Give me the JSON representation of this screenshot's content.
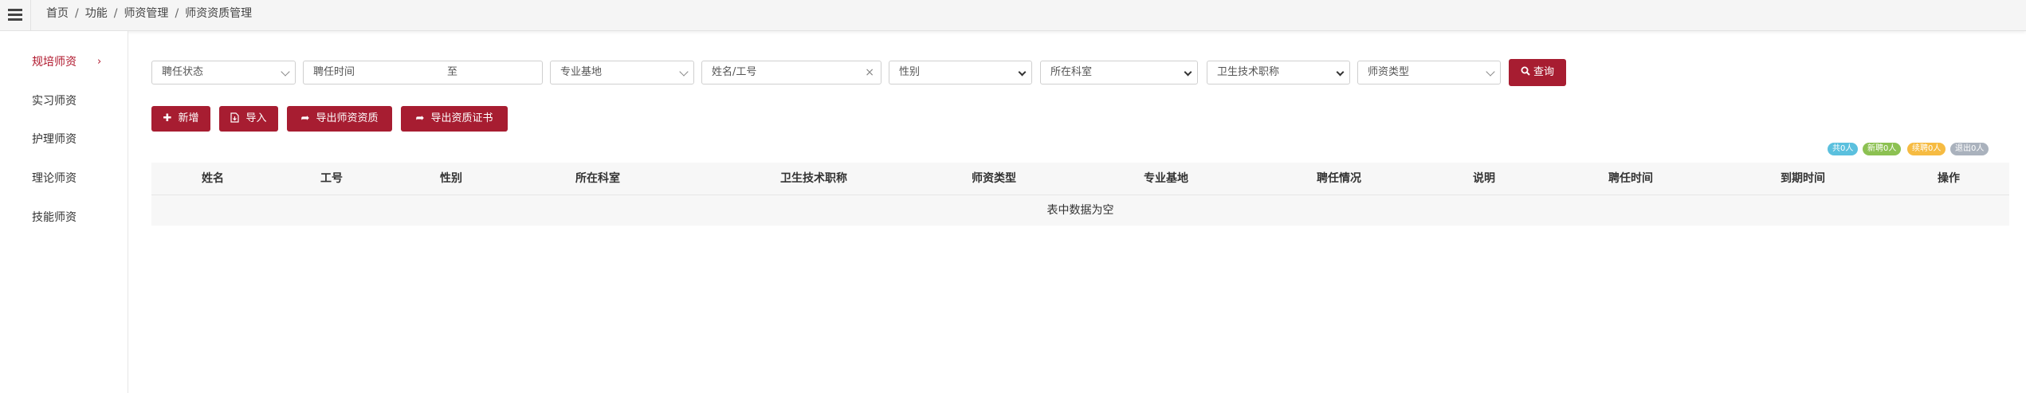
{
  "breadcrumb": [
    "首页",
    "功能",
    "师资管理",
    "师资资质管理"
  ],
  "breadcrumb_sep": "/",
  "sidebar": {
    "items": [
      {
        "label": "规培师资",
        "active": true
      },
      {
        "label": "实习师资"
      },
      {
        "label": "护理师资"
      },
      {
        "label": "理论师资"
      },
      {
        "label": "技能师资"
      }
    ],
    "chevron": "›"
  },
  "filters": {
    "employ_status": "聘任状态",
    "employ_time": "聘任时间",
    "to_label": "至",
    "base": "专业基地",
    "name_placeholder": "姓名/工号",
    "clear": "×",
    "gender": "性别",
    "department": "所在科室",
    "title": "卫生技术职称",
    "teacher_type": "师资类型",
    "query_label": "查询"
  },
  "actions": {
    "add": "新增",
    "import": "导入",
    "export_qual": "导出师资资质",
    "export_cert": "导出资质证书"
  },
  "badges": [
    {
      "label": "共0人",
      "color": "#5bc0de"
    },
    {
      "label": "新聘0人",
      "color": "#8cc152"
    },
    {
      "label": "续聘0人",
      "color": "#f6bb42"
    },
    {
      "label": "退出0人",
      "color": "#aab2bd"
    }
  ],
  "accent_color": "#a71d31",
  "table": {
    "headers": [
      "姓名",
      "工号",
      "性别",
      "所在科室",
      "卫生技术职称",
      "师资类型",
      "专业基地",
      "聘任情况",
      "说明",
      "聘任时间",
      "到期时间",
      "操作"
    ],
    "empty_text": "表中数据为空"
  }
}
